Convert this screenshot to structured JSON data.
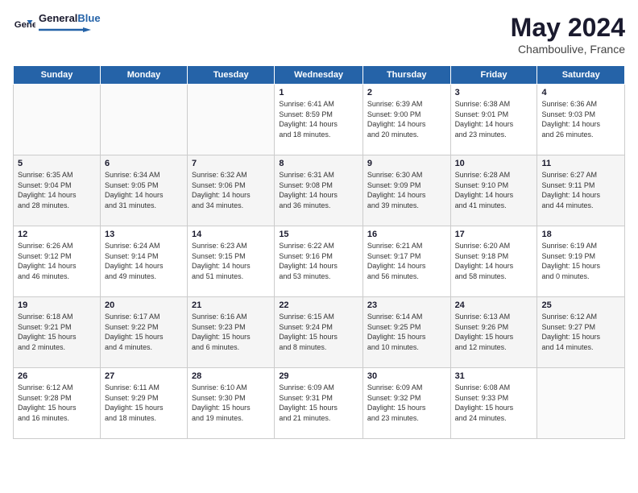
{
  "header": {
    "logo_general": "General",
    "logo_blue": "Blue",
    "month": "May 2024",
    "location": "Chamboulive, France"
  },
  "weekdays": [
    "Sunday",
    "Monday",
    "Tuesday",
    "Wednesday",
    "Thursday",
    "Friday",
    "Saturday"
  ],
  "weeks": [
    [
      {
        "day": "",
        "info": ""
      },
      {
        "day": "",
        "info": ""
      },
      {
        "day": "",
        "info": ""
      },
      {
        "day": "1",
        "info": "Sunrise: 6:41 AM\nSunset: 8:59 PM\nDaylight: 14 hours\nand 18 minutes."
      },
      {
        "day": "2",
        "info": "Sunrise: 6:39 AM\nSunset: 9:00 PM\nDaylight: 14 hours\nand 20 minutes."
      },
      {
        "day": "3",
        "info": "Sunrise: 6:38 AM\nSunset: 9:01 PM\nDaylight: 14 hours\nand 23 minutes."
      },
      {
        "day": "4",
        "info": "Sunrise: 6:36 AM\nSunset: 9:03 PM\nDaylight: 14 hours\nand 26 minutes."
      }
    ],
    [
      {
        "day": "5",
        "info": "Sunrise: 6:35 AM\nSunset: 9:04 PM\nDaylight: 14 hours\nand 28 minutes."
      },
      {
        "day": "6",
        "info": "Sunrise: 6:34 AM\nSunset: 9:05 PM\nDaylight: 14 hours\nand 31 minutes."
      },
      {
        "day": "7",
        "info": "Sunrise: 6:32 AM\nSunset: 9:06 PM\nDaylight: 14 hours\nand 34 minutes."
      },
      {
        "day": "8",
        "info": "Sunrise: 6:31 AM\nSunset: 9:08 PM\nDaylight: 14 hours\nand 36 minutes."
      },
      {
        "day": "9",
        "info": "Sunrise: 6:30 AM\nSunset: 9:09 PM\nDaylight: 14 hours\nand 39 minutes."
      },
      {
        "day": "10",
        "info": "Sunrise: 6:28 AM\nSunset: 9:10 PM\nDaylight: 14 hours\nand 41 minutes."
      },
      {
        "day": "11",
        "info": "Sunrise: 6:27 AM\nSunset: 9:11 PM\nDaylight: 14 hours\nand 44 minutes."
      }
    ],
    [
      {
        "day": "12",
        "info": "Sunrise: 6:26 AM\nSunset: 9:12 PM\nDaylight: 14 hours\nand 46 minutes."
      },
      {
        "day": "13",
        "info": "Sunrise: 6:24 AM\nSunset: 9:14 PM\nDaylight: 14 hours\nand 49 minutes."
      },
      {
        "day": "14",
        "info": "Sunrise: 6:23 AM\nSunset: 9:15 PM\nDaylight: 14 hours\nand 51 minutes."
      },
      {
        "day": "15",
        "info": "Sunrise: 6:22 AM\nSunset: 9:16 PM\nDaylight: 14 hours\nand 53 minutes."
      },
      {
        "day": "16",
        "info": "Sunrise: 6:21 AM\nSunset: 9:17 PM\nDaylight: 14 hours\nand 56 minutes."
      },
      {
        "day": "17",
        "info": "Sunrise: 6:20 AM\nSunset: 9:18 PM\nDaylight: 14 hours\nand 58 minutes."
      },
      {
        "day": "18",
        "info": "Sunrise: 6:19 AM\nSunset: 9:19 PM\nDaylight: 15 hours\nand 0 minutes."
      }
    ],
    [
      {
        "day": "19",
        "info": "Sunrise: 6:18 AM\nSunset: 9:21 PM\nDaylight: 15 hours\nand 2 minutes."
      },
      {
        "day": "20",
        "info": "Sunrise: 6:17 AM\nSunset: 9:22 PM\nDaylight: 15 hours\nand 4 minutes."
      },
      {
        "day": "21",
        "info": "Sunrise: 6:16 AM\nSunset: 9:23 PM\nDaylight: 15 hours\nand 6 minutes."
      },
      {
        "day": "22",
        "info": "Sunrise: 6:15 AM\nSunset: 9:24 PM\nDaylight: 15 hours\nand 8 minutes."
      },
      {
        "day": "23",
        "info": "Sunrise: 6:14 AM\nSunset: 9:25 PM\nDaylight: 15 hours\nand 10 minutes."
      },
      {
        "day": "24",
        "info": "Sunrise: 6:13 AM\nSunset: 9:26 PM\nDaylight: 15 hours\nand 12 minutes."
      },
      {
        "day": "25",
        "info": "Sunrise: 6:12 AM\nSunset: 9:27 PM\nDaylight: 15 hours\nand 14 minutes."
      }
    ],
    [
      {
        "day": "26",
        "info": "Sunrise: 6:12 AM\nSunset: 9:28 PM\nDaylight: 15 hours\nand 16 minutes."
      },
      {
        "day": "27",
        "info": "Sunrise: 6:11 AM\nSunset: 9:29 PM\nDaylight: 15 hours\nand 18 minutes."
      },
      {
        "day": "28",
        "info": "Sunrise: 6:10 AM\nSunset: 9:30 PM\nDaylight: 15 hours\nand 19 minutes."
      },
      {
        "day": "29",
        "info": "Sunrise: 6:09 AM\nSunset: 9:31 PM\nDaylight: 15 hours\nand 21 minutes."
      },
      {
        "day": "30",
        "info": "Sunrise: 6:09 AM\nSunset: 9:32 PM\nDaylight: 15 hours\nand 23 minutes."
      },
      {
        "day": "31",
        "info": "Sunrise: 6:08 AM\nSunset: 9:33 PM\nDaylight: 15 hours\nand 24 minutes."
      },
      {
        "day": "",
        "info": ""
      }
    ]
  ]
}
